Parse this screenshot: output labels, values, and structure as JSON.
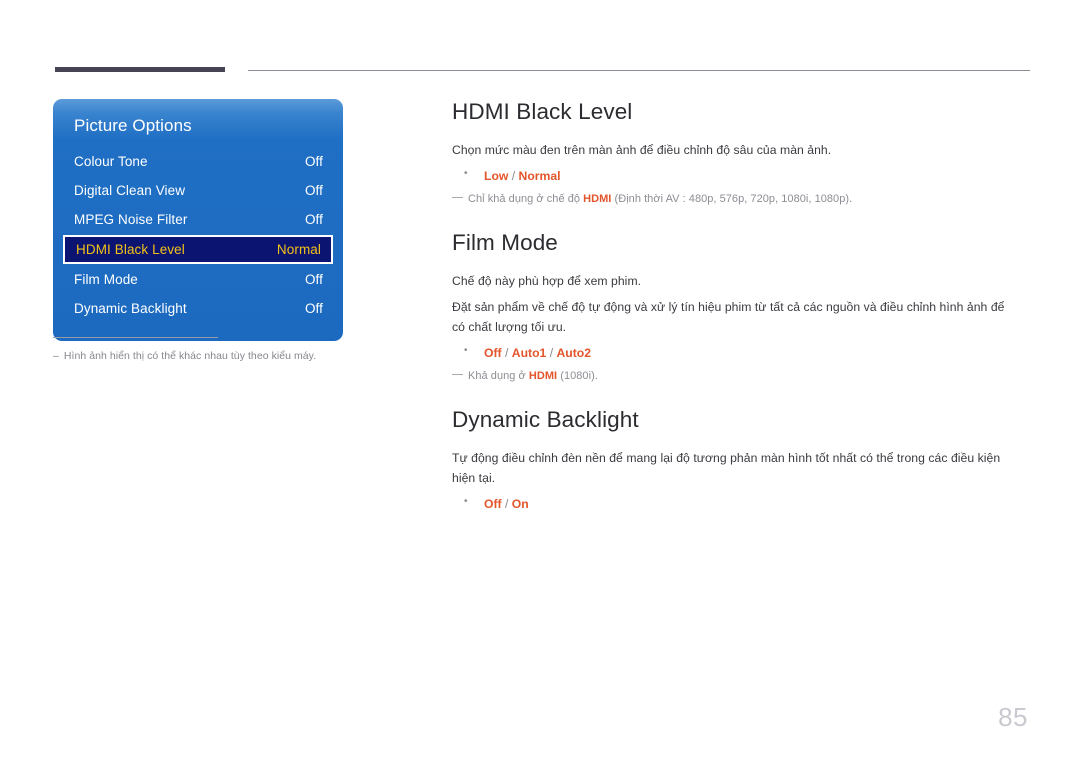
{
  "page": {
    "number": "85",
    "accent_color": "#e3552b",
    "osd_blue": "#1f6fc4",
    "osd_selected_bg": "#0b1470",
    "osd_selected_text": "#f3c218",
    "header_bar_color": "#454354"
  },
  "osd": {
    "title": "Picture Options",
    "rows": [
      {
        "label": "Colour Tone",
        "value": "Off",
        "selected": false
      },
      {
        "label": "Digital Clean View",
        "value": "Off",
        "selected": false
      },
      {
        "label": "MPEG Noise Filter",
        "value": "Off",
        "selected": false
      },
      {
        "label": "HDMI Black Level",
        "value": "Normal",
        "selected": true
      },
      {
        "label": "Film Mode",
        "value": "Off",
        "selected": false
      },
      {
        "label": "Dynamic Backlight",
        "value": "Off",
        "selected": false
      }
    ],
    "footnote": "Hình ảnh hiển thị có thể khác nhau tùy theo kiểu máy.",
    "footnote_dash": "–"
  },
  "sections": [
    {
      "heading": "HDMI Black Level",
      "body": [
        "Chọn mức màu đen trên màn ảnh để điều chỉnh độ sâu của màn ảnh."
      ],
      "options": [
        "Low",
        "Normal"
      ],
      "notes": [
        {
          "before": "Chỉ khả dụng ở chế độ ",
          "bold": "HDMI",
          "after": " (Định thời AV : 480p, 576p, 720p, 1080i, 1080p)."
        }
      ]
    },
    {
      "heading": "Film Mode",
      "body": [
        "Chế độ này phù hợp để xem phim.",
        "Đặt sản phẩm về chế độ tự động và xử lý tín hiệu phim từ tất cả các nguồn và điều chỉnh hình ảnh để có chất lượng tối ưu."
      ],
      "options": [
        "Off",
        "Auto1",
        "Auto2"
      ],
      "notes": [
        {
          "before": "Khả dụng ở ",
          "bold": "HDMI",
          "after": " (1080i)."
        }
      ]
    },
    {
      "heading": "Dynamic Backlight",
      "body": [
        "Tự động điều chỉnh đèn nền để mang lại độ tương phản màn hình tốt nhất có thể trong các điều kiện hiện tại."
      ],
      "options": [
        "Off",
        "On"
      ],
      "notes": []
    }
  ]
}
